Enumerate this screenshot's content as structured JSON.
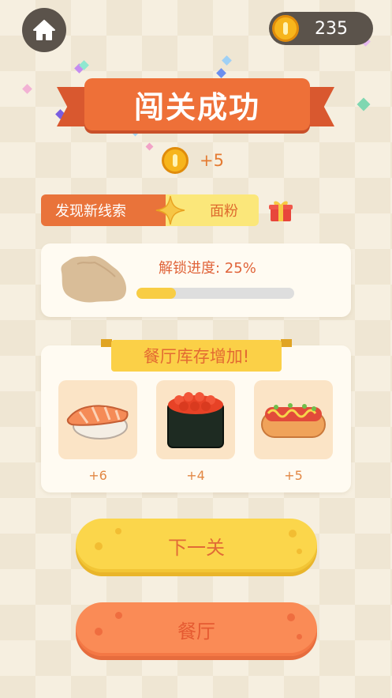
{
  "header": {
    "home_icon": "home-icon",
    "coin_icon": "coin-icon",
    "coin_balance": "235"
  },
  "title_banner": {
    "text": "闯关成功"
  },
  "reward": {
    "coin_icon": "coin-icon",
    "amount": "+5"
  },
  "clue": {
    "label": "发现新线索",
    "item_name": "面粉",
    "sparkle_icon": "sparkle-icon",
    "gift_icon": "gift-icon"
  },
  "unlock": {
    "label": "解锁进度: 25%",
    "progress": 0.25,
    "item_icon": "flour-pile-icon"
  },
  "stock": {
    "title": "餐厅库存增加!",
    "items": [
      {
        "icon": "salmon-sushi-icon",
        "count": "+6"
      },
      {
        "icon": "roe-gunkan-icon",
        "count": "+4"
      },
      {
        "icon": "hotdog-icon",
        "count": "+5"
      }
    ]
  },
  "buttons": {
    "next_level": "下一关",
    "restaurant": "餐厅"
  },
  "colors": {
    "accent_orange": "#ee7038",
    "accent_yellow": "#fbd64b",
    "dark_pill": "#5b534b",
    "background": "#f6efe0"
  }
}
